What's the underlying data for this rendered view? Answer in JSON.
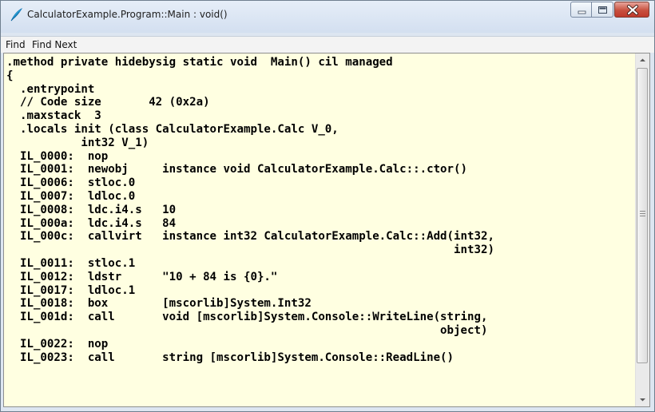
{
  "window": {
    "title": "CalculatorExample.Program::Main : void()"
  },
  "menu": {
    "items": [
      "Find",
      "Find Next"
    ]
  },
  "code": {
    "lines": [
      ".method private hidebysig static void  Main() cil managed",
      "{",
      "  .entrypoint",
      "  // Code size       42 (0x2a)",
      "  .maxstack  3",
      "  .locals init (class CalculatorExample.Calc V_0,",
      "           int32 V_1)",
      "  IL_0000:  nop",
      "  IL_0001:  newobj     instance void CalculatorExample.Calc::.ctor()",
      "  IL_0006:  stloc.0",
      "  IL_0007:  ldloc.0",
      "  IL_0008:  ldc.i4.s   10",
      "  IL_000a:  ldc.i4.s   84",
      "  IL_000c:  callvirt   instance int32 CalculatorExample.Calc::Add(int32,",
      "                                                                  int32)",
      "  IL_0011:  stloc.1",
      "  IL_0012:  ldstr      \"10 + 84 is {0}.\"",
      "  IL_0017:  ldloc.1",
      "  IL_0018:  box        [mscorlib]System.Int32",
      "  IL_001d:  call       void [mscorlib]System.Console::WriteLine(string,",
      "                                                                object)",
      "  IL_0022:  nop",
      "  IL_0023:  call       string [mscorlib]System.Console::ReadLine()"
    ]
  },
  "icons": {
    "app": "feather-icon",
    "minimize": "minimize-icon",
    "maximize": "maximize-icon",
    "close": "close-icon",
    "scroll_up": "scroll-up-arrow-icon",
    "scroll_down": "scroll-down-arrow-icon"
  },
  "colors": {
    "editor_background": "#ffffe1",
    "close_button": "#c8513f",
    "code_text": "#000000"
  }
}
